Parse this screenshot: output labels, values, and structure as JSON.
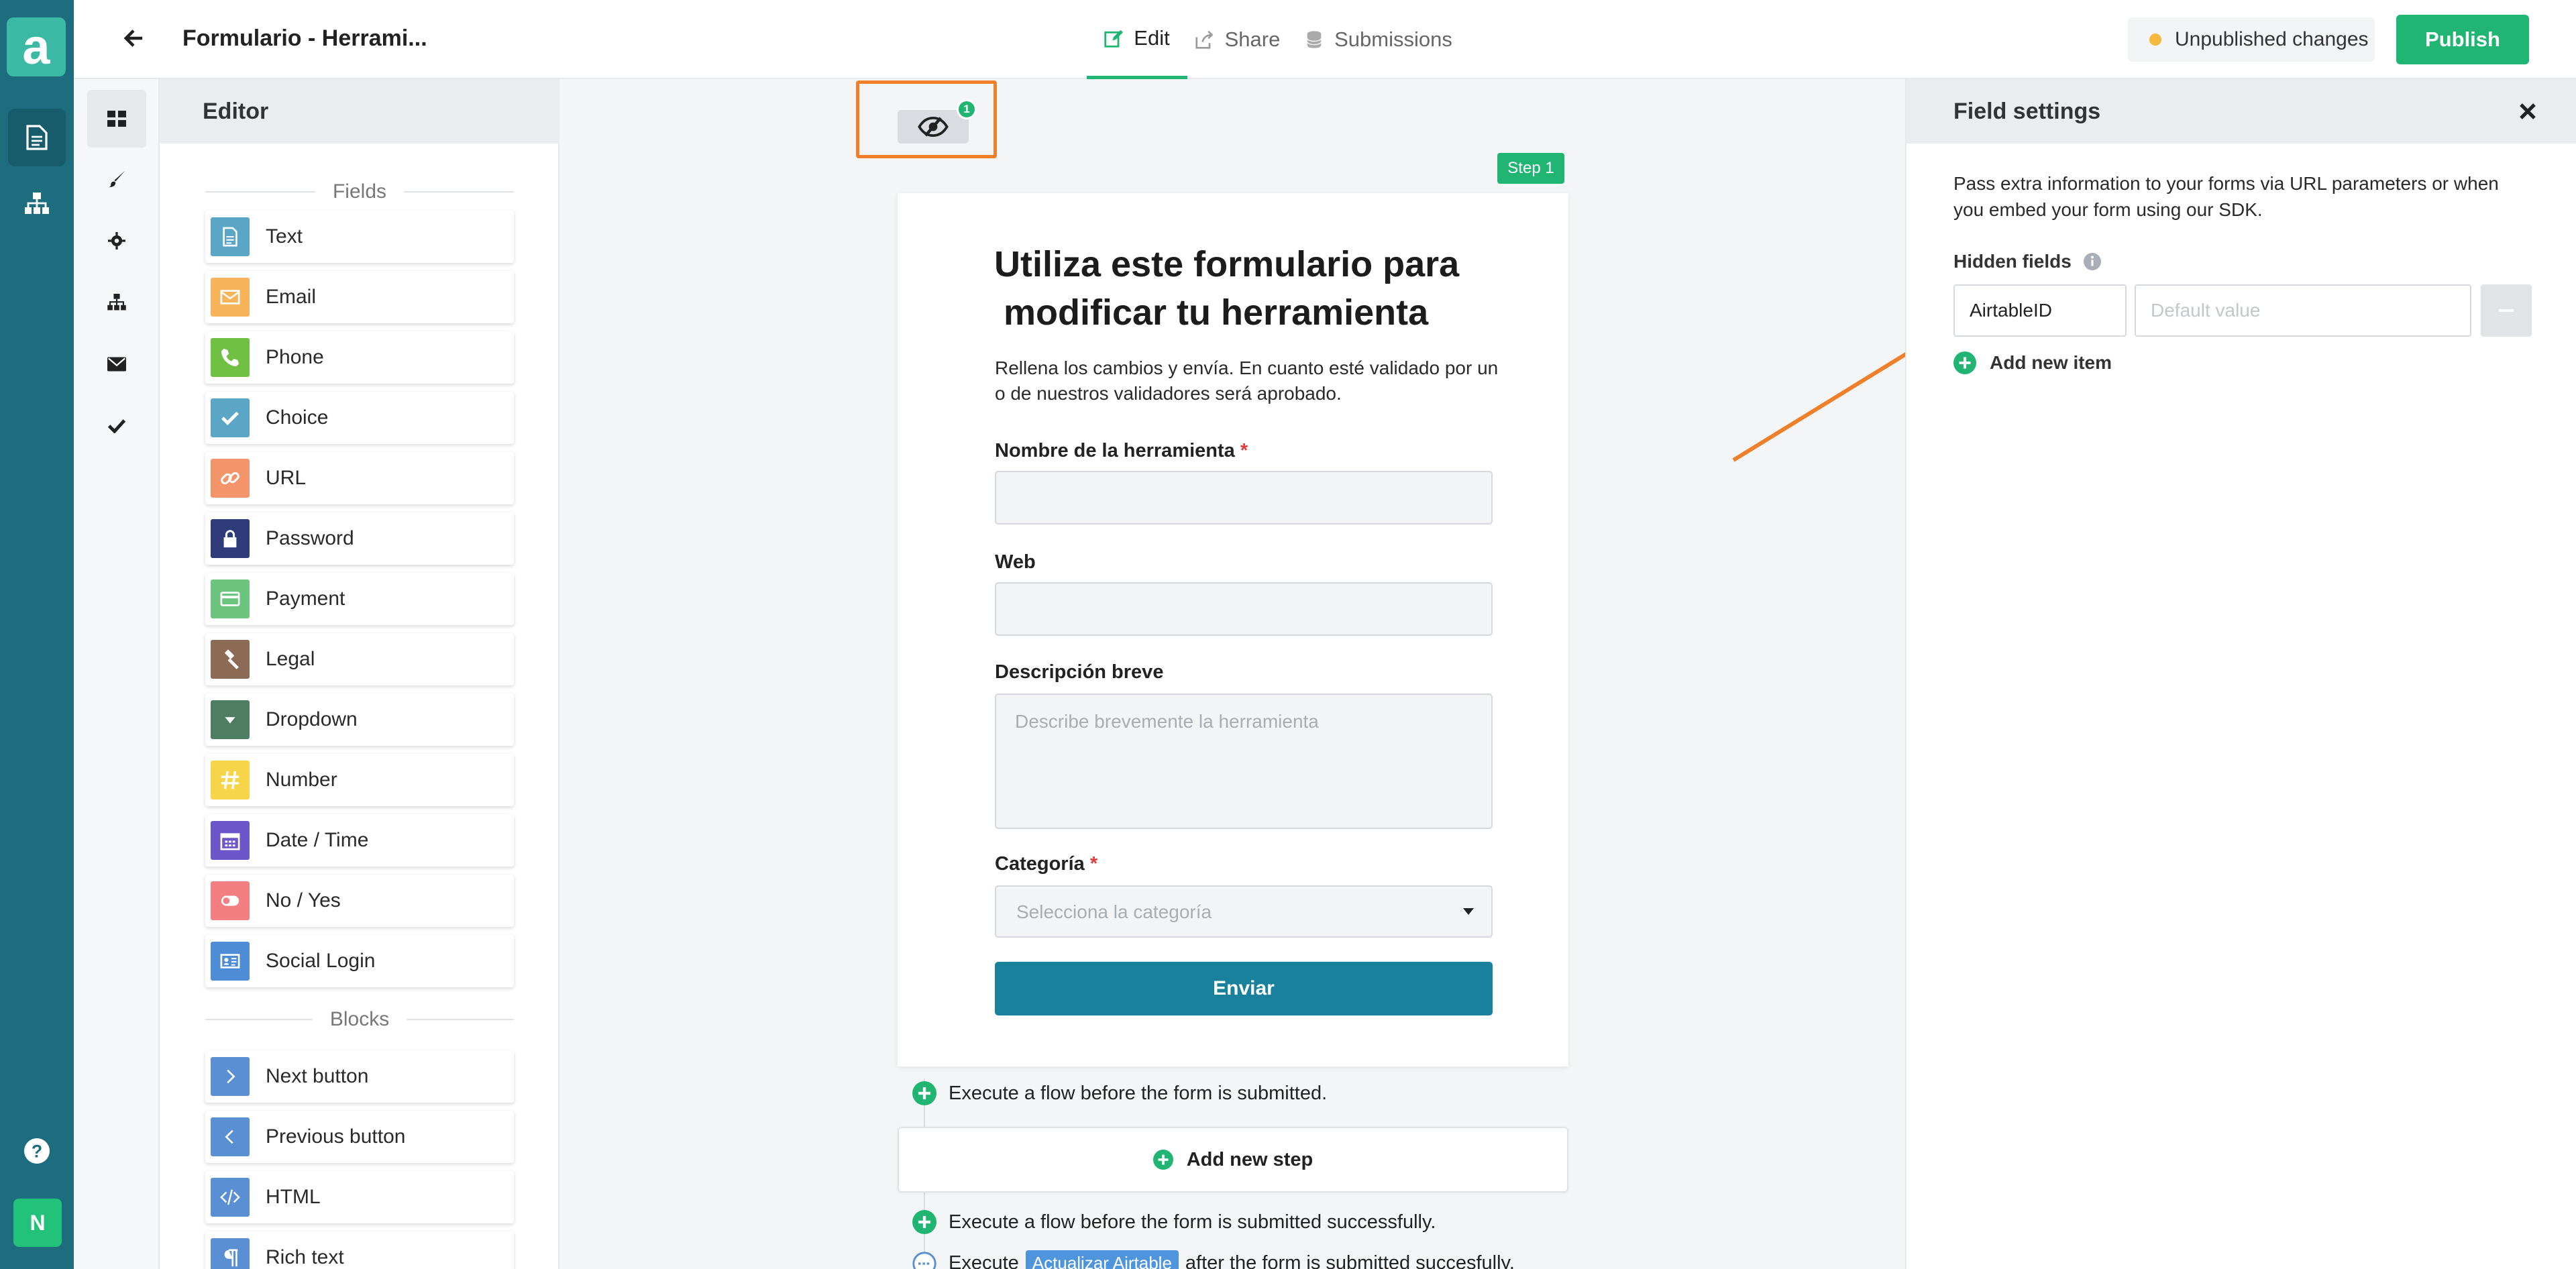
{
  "app": {
    "logo_letter": "a",
    "user_initial": "N"
  },
  "header": {
    "form_title": "Formulario - Herrami...",
    "tabs": [
      {
        "label": "Edit",
        "icon": "pencil-square-icon",
        "active": true
      },
      {
        "label": "Share",
        "icon": "share-icon",
        "active": false
      },
      {
        "label": "Submissions",
        "icon": "database-icon",
        "active": false
      }
    ],
    "status": "Unpublished changes",
    "publish_label": "Publish",
    "status_color": "#f5b93d",
    "accent": "#21b573"
  },
  "toolbar": {
    "hidden_count": "1",
    "step_label": "Step 1"
  },
  "editor": {
    "title": "Editor",
    "fields_heading": "Fields",
    "fields": [
      {
        "label": "Text",
        "icon": "document-icon",
        "color": "#5ba6c6"
      },
      {
        "label": "Email",
        "icon": "envelope-icon",
        "color": "#f7b45a"
      },
      {
        "label": "Phone",
        "icon": "phone-icon",
        "color": "#6fc043"
      },
      {
        "label": "Choice",
        "icon": "check-icon",
        "color": "#5ba6c6"
      },
      {
        "label": "URL",
        "icon": "link-icon",
        "color": "#f4946a"
      },
      {
        "label": "Password",
        "icon": "lock-icon",
        "color": "#2f3c7a"
      },
      {
        "label": "Payment",
        "icon": "credit-card-icon",
        "color": "#6cc47f"
      },
      {
        "label": "Legal",
        "icon": "gavel-icon",
        "color": "#8b6a56"
      },
      {
        "label": "Dropdown",
        "icon": "caret-down-icon",
        "color": "#4f7d64"
      },
      {
        "label": "Number",
        "icon": "hash-icon",
        "color": "#f7d54a"
      },
      {
        "label": "Date / Time",
        "icon": "calendar-icon",
        "color": "#6b57c9"
      },
      {
        "label": "No / Yes",
        "icon": "toggle-icon",
        "color": "#f37f82"
      },
      {
        "label": "Social Login",
        "icon": "id-card-icon",
        "color": "#4e8cd6"
      }
    ],
    "blocks_heading": "Blocks",
    "blocks": [
      {
        "label": "Next button",
        "icon": "chevron-right-icon",
        "color": "#5a8fd4"
      },
      {
        "label": "Previous button",
        "icon": "chevron-left-icon",
        "color": "#5a8fd4"
      },
      {
        "label": "HTML",
        "icon": "code-icon",
        "color": "#5a8fd4"
      },
      {
        "label": "Rich text",
        "icon": "paragraph-icon",
        "color": "#5a8fd4"
      }
    ]
  },
  "form": {
    "title_line1": "Utiliza este formulario para",
    "title_line2": "modificar tu herramienta",
    "description_line1": "Rellena los cambios y envía. En cuanto esté validado por un",
    "description_line2": "o de nuestros validadores será aprobado.",
    "fields": {
      "name_label": "Nombre de la herramienta",
      "web_label": "Web",
      "desc_label": "Descripción breve",
      "desc_placeholder": "Describe brevemente la herramienta",
      "category_label": "Categoría",
      "category_placeholder": "Selecciona la categoría",
      "required_mark": "*"
    },
    "submit_label": "Enviar",
    "submit_color": "#19819c"
  },
  "flows": {
    "before_submit": "Execute a flow before the form is submitted.",
    "add_step": "Add new step",
    "before_success": "Execute a flow before the form is submitted successfully.",
    "after_prefix": "Execute",
    "after_tag": "Actualizar Airtable",
    "after_suffix": "after the form is submitted succesfully."
  },
  "settings": {
    "title": "Field settings",
    "description_line1": "Pass extra information to your forms via URL parameters or when",
    "description_line2": "you embed your form using our SDK.",
    "hidden_fields_label": "Hidden fields",
    "hidden_field_name": "AirtableID",
    "default_value_placeholder": "Default value",
    "add_item_label": "Add new item"
  },
  "annotation": {
    "highlight_color": "#f07f2a"
  }
}
